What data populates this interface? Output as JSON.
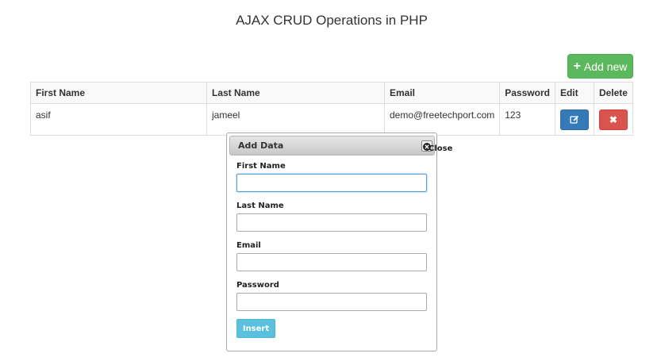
{
  "page": {
    "title": "AJAX CRUD Operations in PHP"
  },
  "toolbar": {
    "add_new_label": "Add new",
    "add_new_icon": "plus-icon"
  },
  "table": {
    "headers": [
      "First Name",
      "Last Name",
      "Email",
      "Password",
      "Edit",
      "Delete"
    ],
    "rows": [
      {
        "first_name": "asif",
        "last_name": "jameel",
        "email": "demo@freetechport.com",
        "password": "123"
      }
    ]
  },
  "dialog": {
    "title": "Add Data",
    "close_label": "Close",
    "fields": [
      {
        "label": "First Name",
        "value": ""
      },
      {
        "label": "Last Name",
        "value": ""
      },
      {
        "label": "Email",
        "value": ""
      },
      {
        "label": "Password",
        "value": ""
      }
    ],
    "insert_label": "Insert"
  },
  "colors": {
    "add_button": "#5cb85c",
    "edit_button": "#337ab7",
    "delete_button": "#d9534f",
    "insert_button": "#5bc0de"
  }
}
